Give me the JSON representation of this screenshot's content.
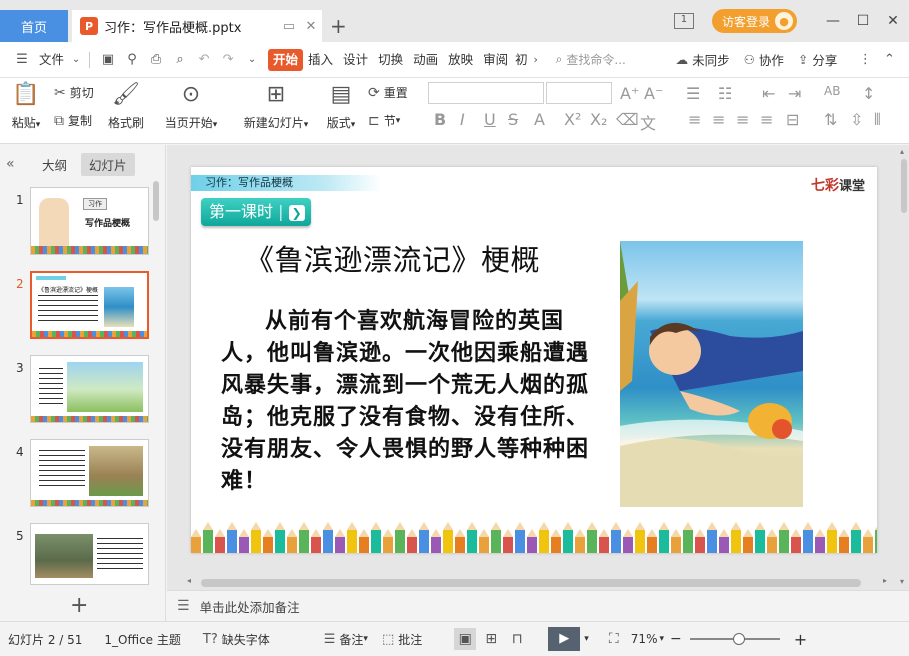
{
  "titlebar": {
    "home_tab": "首页",
    "doc_tab_badge": "P",
    "doc_tab_title": "习作：写作品梗概.pptx",
    "page_count_icon": "1",
    "login_label": "访客登录"
  },
  "menu": {
    "file": "文件",
    "tabs": [
      "开始",
      "插入",
      "设计",
      "切换",
      "动画",
      "放映",
      "审阅",
      "初"
    ],
    "search_placeholder": "查找命令...",
    "sync": "未同步",
    "collab": "协作",
    "share": "分享"
  },
  "ribbon": {
    "paste": "粘贴",
    "cut": "剪切",
    "copy": "复制",
    "format_painter": "格式刷",
    "start_from_current": "当页开始",
    "new_slide": "新建幻灯片",
    "layout": "版式",
    "reset": "重置",
    "section": "节"
  },
  "leftpanel": {
    "outline_tab": "大纲",
    "slides_tab": "幻灯片",
    "thumbnails": [
      {
        "num": "1",
        "text": "写作品梗概",
        "chip": "习作"
      },
      {
        "num": "2",
        "text": "《鲁滨逊漂流记》梗概"
      },
      {
        "num": "3",
        "text": ""
      },
      {
        "num": "4",
        "text": ""
      },
      {
        "num": "5",
        "text": ""
      }
    ]
  },
  "slide": {
    "header_label": "习作：写作品梗概",
    "brand": "七彩",
    "brand_suffix": "课堂",
    "lesson_label": "第一课时",
    "title": "《鲁滨逊漂流记》梗概",
    "body": "从前有个喜欢航海冒险的英国人，他叫鲁滨逊。一次他因乘船遭遇风暴失事，漂流到一个荒无人烟的孤岛；他克服了没有食物、没有住所、没有朋友、令人畏惧的野人等种种困难！"
  },
  "notes": {
    "placeholder": "单击此处添加备注"
  },
  "status": {
    "slide_info": "幻灯片 2 / 51",
    "theme": "1_Office 主题",
    "missing_font": "缺失字体",
    "notes_btn": "备注",
    "comment_btn": "批注",
    "zoom": "71%"
  },
  "colors": {
    "accent": "#e8592b",
    "home_tab": "#4a90e2",
    "login": "#f29f2e",
    "lesson_btn": "#1ab5a7"
  }
}
